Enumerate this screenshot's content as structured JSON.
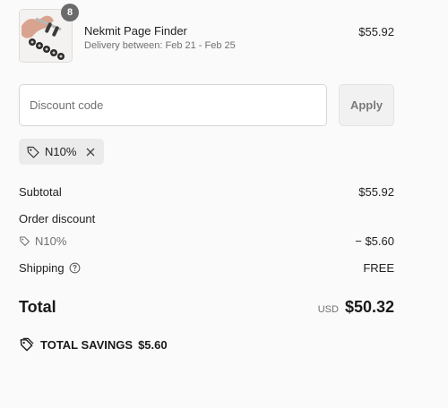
{
  "product": {
    "quantity": "8",
    "title": "Nekmit Page Finder",
    "delivery": "Delivery between: Feb 21 - Feb 25",
    "price": "$55.92",
    "image_icon": "product-thumbnail"
  },
  "discount": {
    "placeholder": "Discount code",
    "value": "",
    "apply_label": "Apply",
    "applied_code": "N10%"
  },
  "summary": {
    "subtotal_label": "Subtotal",
    "subtotal_value": "$55.92",
    "order_discount_label": "Order discount",
    "discount_code": "N10%",
    "discount_value": "− $5.60",
    "shipping_label": "Shipping",
    "shipping_value": "FREE",
    "total_label": "Total",
    "currency": "USD",
    "total_value": "$50.32",
    "savings_label": "TOTAL SAVINGS",
    "savings_value": "$5.60"
  },
  "colors": {
    "background": "#fafafa",
    "badge": "#6b6b6b",
    "muted_text": "#707070",
    "chip_bg": "#ebebeb"
  }
}
